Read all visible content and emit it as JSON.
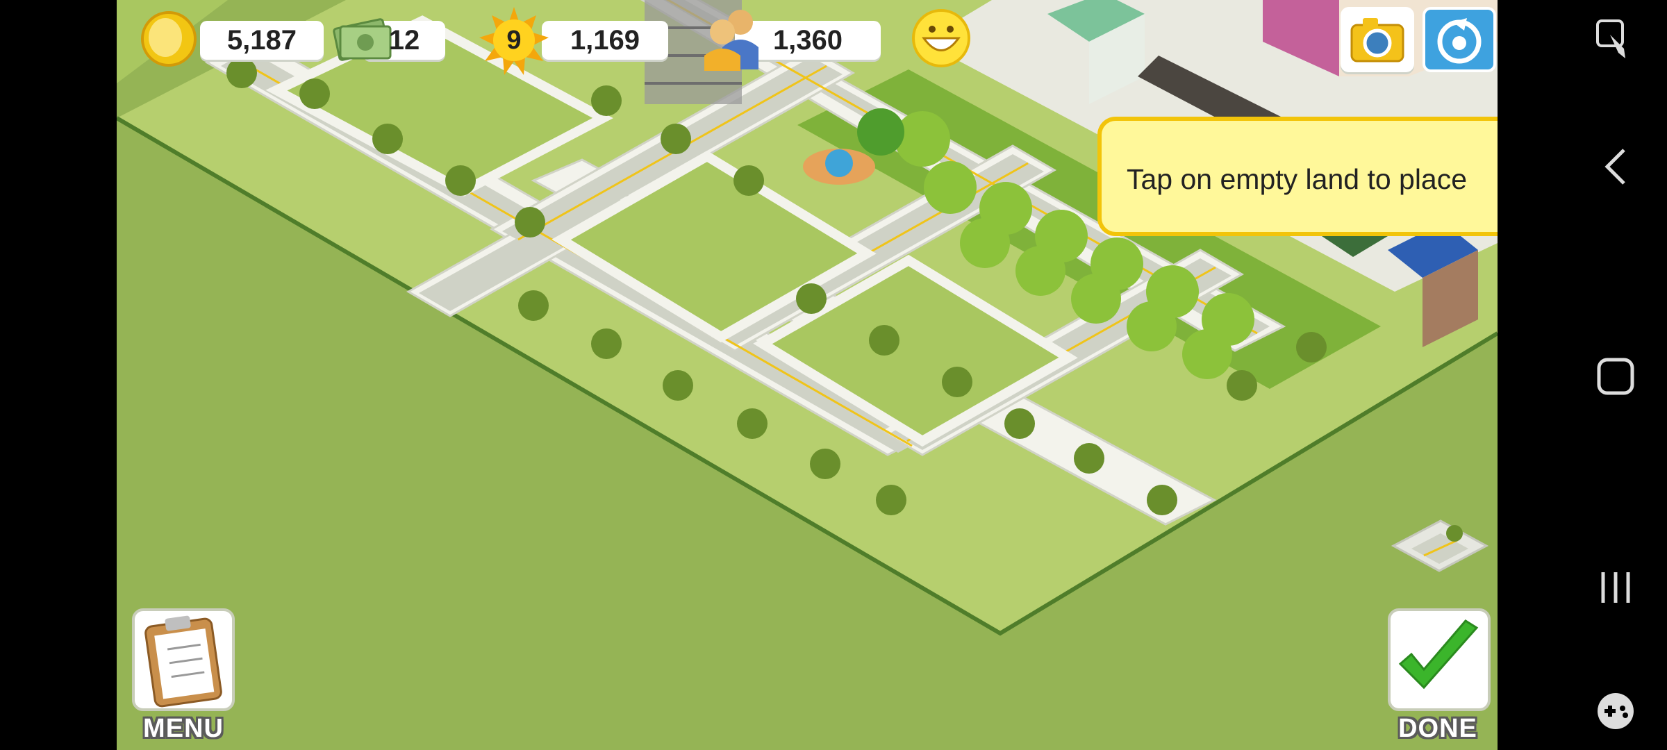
{
  "hud": {
    "coins": "5,187",
    "cash": "12",
    "level": "9",
    "experience": "1,169",
    "population": "1,360"
  },
  "tooltip": {
    "text": "Tap on empty land to place"
  },
  "buttons": {
    "menu_label": "MENU",
    "done_label": "DONE"
  },
  "icons": {
    "coin": "coin-icon",
    "cash": "cash-icon",
    "level": "level-sun-icon",
    "population": "population-icon",
    "happiness": "happiness-icon",
    "camera": "camera-icon",
    "share": "share-icon",
    "road_tool": "road-tile-icon",
    "menu": "clipboard-icon",
    "done": "checkmark-icon"
  },
  "colors": {
    "grass": "#95b455",
    "plot": "#a9c760",
    "road": "#d9dbd4",
    "sidewalk": "#f3f3ec",
    "line": "#f0c419",
    "tooltip_bg": "#fff89a",
    "tooltip_border": "#f2c40a",
    "check": "#3bb52b"
  },
  "system_nav": [
    "screenshot-icon",
    "back-icon",
    "home-icon",
    "recents-icon",
    "gamepad-icon"
  ]
}
